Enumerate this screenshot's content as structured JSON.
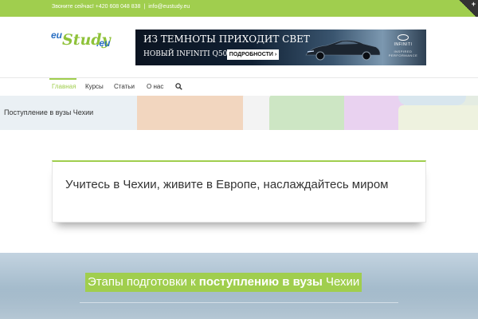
{
  "topbar": {
    "phone_text": "Звоните сейчас! +420 608 048 838",
    "separator": "|",
    "email": "info@eustudy.eu",
    "corner_icon": "plus-icon"
  },
  "logo": {
    "part1": "eu",
    "part2": "Study",
    "part3": ".eu"
  },
  "banner": {
    "line1": "ИЗ ТЕМНОТЫ ПРИХОДИТ СВЕТ",
    "line2": "НОВЫЙ INFINITI Q50",
    "button": "ПОДРОБНОСТИ ›",
    "brand": "INFINITI",
    "tagline": "INSPIRED PERFORMANCE"
  },
  "nav": {
    "items": [
      {
        "label": "Главная",
        "active": true
      },
      {
        "label": "Курсы",
        "active": false
      },
      {
        "label": "Статьи",
        "active": false
      },
      {
        "label": "О нас",
        "active": false
      }
    ],
    "search_icon": "search-icon"
  },
  "page": {
    "title": "Поступление в вузы Чехии"
  },
  "content": {
    "headline": "Учитесь в Чехии, живите в Европе, наслаждайтесь миром"
  },
  "hero": {
    "pre": "Этапы подготовки к ",
    "bold": "поступлению в вузы",
    "post": " Чехии"
  },
  "colors": {
    "accent": "#a0ce4e",
    "logo_blue": "#2a6fc2",
    "text": "#333333"
  }
}
